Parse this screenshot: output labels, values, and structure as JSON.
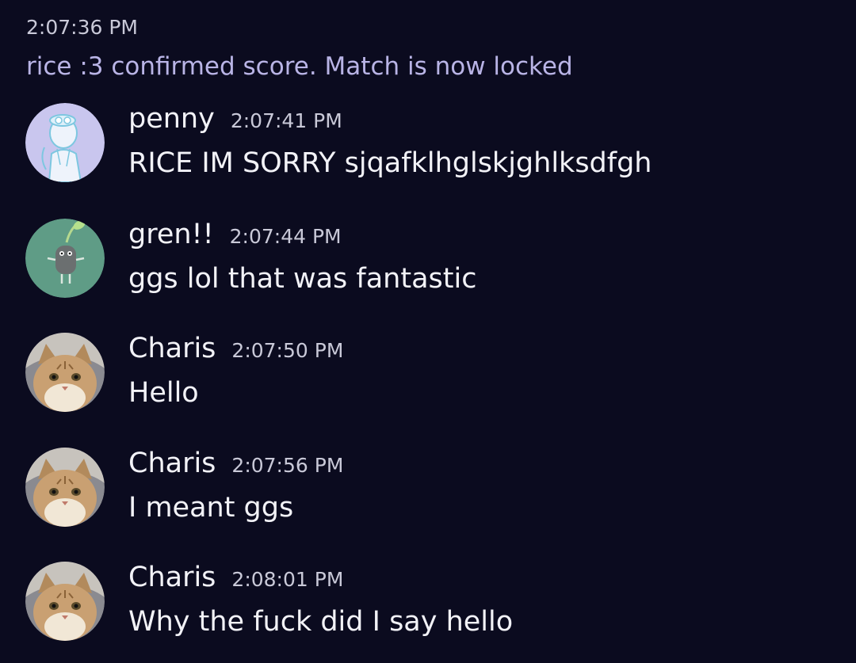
{
  "system_message": {
    "time": "2:07:36 PM",
    "text": "rice :3 confirmed score. Match is now locked"
  },
  "messages": [
    {
      "author": "penny",
      "time": "2:07:41 PM",
      "text": "RICE IM SORRY sjqafklhglskjghlksdfgh",
      "avatar": "penny-avatar"
    },
    {
      "author": "gren!!",
      "time": "2:07:44 PM",
      "text": "ggs lol that was fantastic",
      "avatar": "gren-avatar"
    },
    {
      "author": "Charis",
      "time": "2:07:50 PM",
      "text": "Hello",
      "avatar": "cat-avatar"
    },
    {
      "author": "Charis",
      "time": "2:07:56 PM",
      "text": "I meant ggs",
      "avatar": "cat-avatar"
    },
    {
      "author": "Charis",
      "time": "2:08:01 PM",
      "text": "Why the fuck did I say hello",
      "avatar": "cat-avatar"
    }
  ],
  "colors": {
    "background": "#0b0b1f",
    "system_text": "#b9b4e6",
    "timestamp": "#c9c9d8",
    "text": "#f2f2f7"
  }
}
